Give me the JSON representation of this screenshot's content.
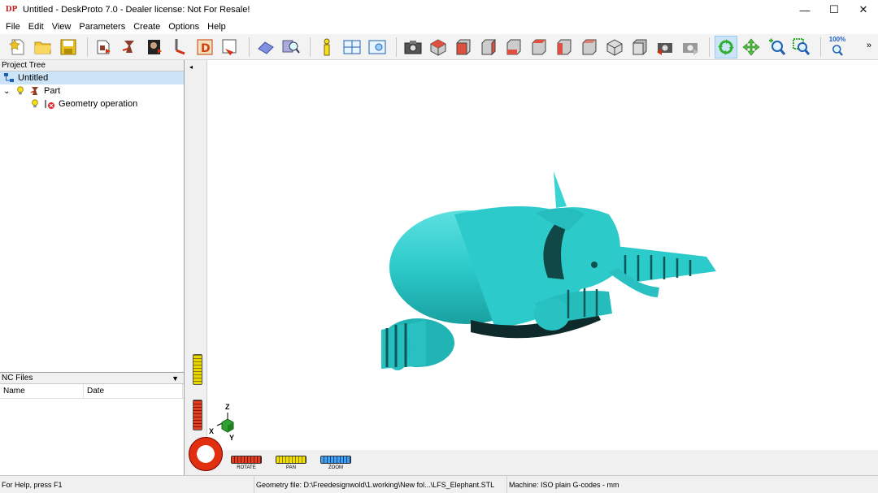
{
  "window": {
    "title": "Untitled - DeskProto 7.0 - Dealer license: Not For Resale!",
    "app_icon_text": "DP",
    "minimize": "—",
    "maximize": "☐",
    "close": "✕"
  },
  "menu": [
    "File",
    "Edit",
    "View",
    "Parameters",
    "Create",
    "Options",
    "Help"
  ],
  "toolbar": {
    "zoom_label": "100%",
    "more": "»"
  },
  "project_tree": {
    "header": "Project Tree",
    "root": "Untitled",
    "part": "Part",
    "operation": "Geometry operation",
    "expander": "⌄"
  },
  "nc_files": {
    "header": "NC Files",
    "dropdown": "▼",
    "columns": [
      "Name",
      "Date"
    ]
  },
  "viewport": {
    "collapse": "◂",
    "model_color": "#2ecccc",
    "controls": [
      {
        "label": "ROTATE",
        "color": "red"
      },
      {
        "label": "PAN",
        "color": "yellow"
      },
      {
        "label": "ZOOM",
        "color": "blue"
      }
    ],
    "axes": {
      "x": "X",
      "y": "Y",
      "z": "Z"
    }
  },
  "status": {
    "help": "For Help, press F1",
    "geometry": "Geometry file: D:\\Freedesignwold\\1.working\\New fol...\\LFS_Elephant.STL",
    "machine": "Machine: ISO plain G-codes - mm"
  }
}
